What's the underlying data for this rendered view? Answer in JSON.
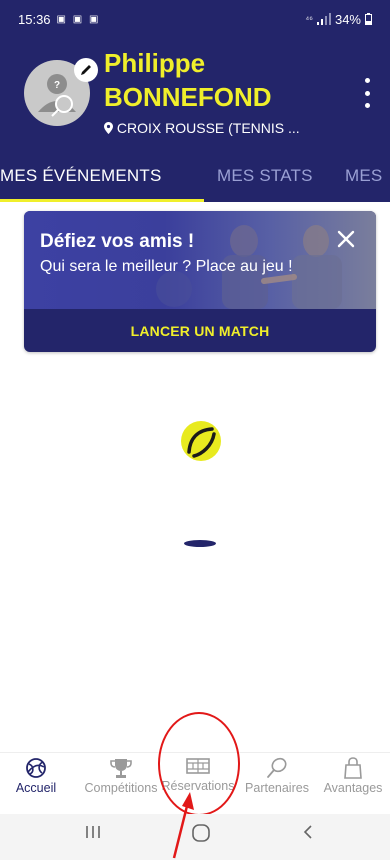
{
  "status_bar": {
    "time": "15:36",
    "notif_icons": "▣ ▣ ▣",
    "network": "⁴⁶",
    "battery": "34%"
  },
  "profile": {
    "first_name": "Philippe",
    "last_name": "BONNEFOND",
    "club": "CROIX ROUSSE (TENNIS ..."
  },
  "tabs": [
    {
      "label": "MES ÉVÉNEMENTS",
      "active": true
    },
    {
      "label": "MES STATS",
      "active": false
    },
    {
      "label": "MES",
      "active": false
    }
  ],
  "promo": {
    "title": "Défiez vos amis !",
    "subtitle": "Qui sera le meilleur ? Place au jeu !",
    "cta": "LANCER UN MATCH"
  },
  "bottom_nav": [
    {
      "label": "Accueil",
      "icon": "tennis-ball-icon",
      "active": true
    },
    {
      "label": "Compétitions",
      "icon": "trophy-icon",
      "active": false
    },
    {
      "label": "Réservations",
      "icon": "court-icon",
      "active": false
    },
    {
      "label": "Partenaires",
      "icon": "racket-icon",
      "active": false
    },
    {
      "label": "Avantages",
      "icon": "bag-icon",
      "active": false
    }
  ],
  "colors": {
    "primary": "#23256a",
    "accent": "#f0ef2b",
    "inactive": "#9a9a9a",
    "annotation": "#e21818"
  }
}
